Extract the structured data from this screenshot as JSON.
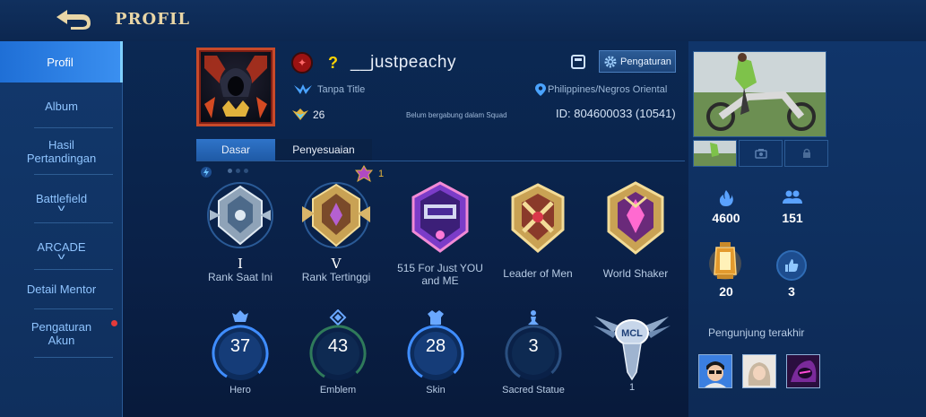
{
  "header": {
    "title": "PROFIL"
  },
  "sidebar": {
    "items": [
      {
        "label": "Profil"
      },
      {
        "label": "Album"
      },
      {
        "label": "Hasil Pertandingan"
      },
      {
        "label": "Battlefield"
      },
      {
        "label": "ARCADE"
      },
      {
        "label": "Detail Mentor"
      },
      {
        "label": "Pengaturan Akun"
      }
    ]
  },
  "profile": {
    "name": "__justpeachy",
    "clan_mark": "?",
    "title": "Tanpa Title",
    "level": "26",
    "squad": "Belum bergabung dalam Squad",
    "location": "Philippines/Negros Oriental",
    "id": "ID: 804600033 (10541)",
    "settings_label": "Pengaturan"
  },
  "tabs": [
    {
      "label": "Dasar"
    },
    {
      "label": "Penyesuaian"
    }
  ],
  "medals": [
    {
      "roman": "I",
      "label": "Rank Saat Ini"
    },
    {
      "roman": "V",
      "label": "Rank Tertinggi"
    },
    {
      "roman": "",
      "label": "515 For Just YOU and ME"
    },
    {
      "roman": "",
      "label": "Leader of Men"
    },
    {
      "roman": "",
      "label": "World Shaker"
    }
  ],
  "highest_rank_stars": "1",
  "stats": [
    {
      "value": "37",
      "label": "Hero"
    },
    {
      "value": "43",
      "label": "Emblem"
    },
    {
      "value": "28",
      "label": "Skin"
    },
    {
      "value": "3",
      "label": "Sacred Statue"
    },
    {
      "value": "",
      "label": "1"
    }
  ],
  "mcl_badge_text": "MCL",
  "right": {
    "popularity": "4600",
    "followers": "151",
    "lanterns": "20",
    "likes": "3",
    "visitors_label": "Pengunjung terakhir"
  },
  "colors": {
    "accent": "#2f74c9",
    "gold": "#e9d6a6",
    "ring": "#3f8dff"
  }
}
